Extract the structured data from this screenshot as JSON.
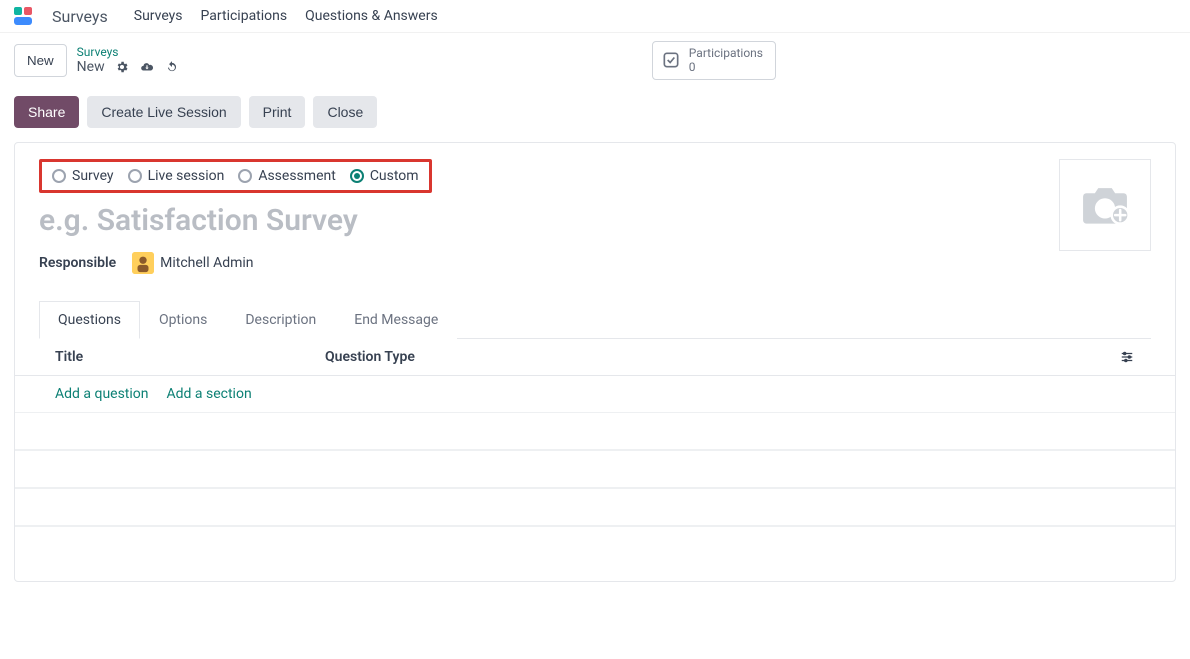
{
  "brand": "Surveys",
  "nav": {
    "surveys": "Surveys",
    "participations": "Participations",
    "qa": "Questions & Answers"
  },
  "new_button": "New",
  "breadcrumb": {
    "root": "Surveys",
    "current": "New"
  },
  "stats": {
    "label": "Participations",
    "count": "0"
  },
  "actions": {
    "share": "Share",
    "live": "Create Live Session",
    "print": "Print",
    "close": "Close"
  },
  "radios": {
    "survey": {
      "label": "Survey",
      "selected": false
    },
    "live": {
      "label": "Live session",
      "selected": false
    },
    "assessment": {
      "label": "Assessment",
      "selected": false
    },
    "custom": {
      "label": "Custom",
      "selected": true
    }
  },
  "title_placeholder": "e.g. Satisfaction Survey",
  "responsible": {
    "label": "Responsible",
    "name": "Mitchell Admin"
  },
  "tabs": {
    "questions": "Questions",
    "options": "Options",
    "description": "Description",
    "end": "End Message"
  },
  "table": {
    "title_col": "Title",
    "type_col": "Question Type",
    "add_question": "Add a question",
    "add_section": "Add a section"
  }
}
